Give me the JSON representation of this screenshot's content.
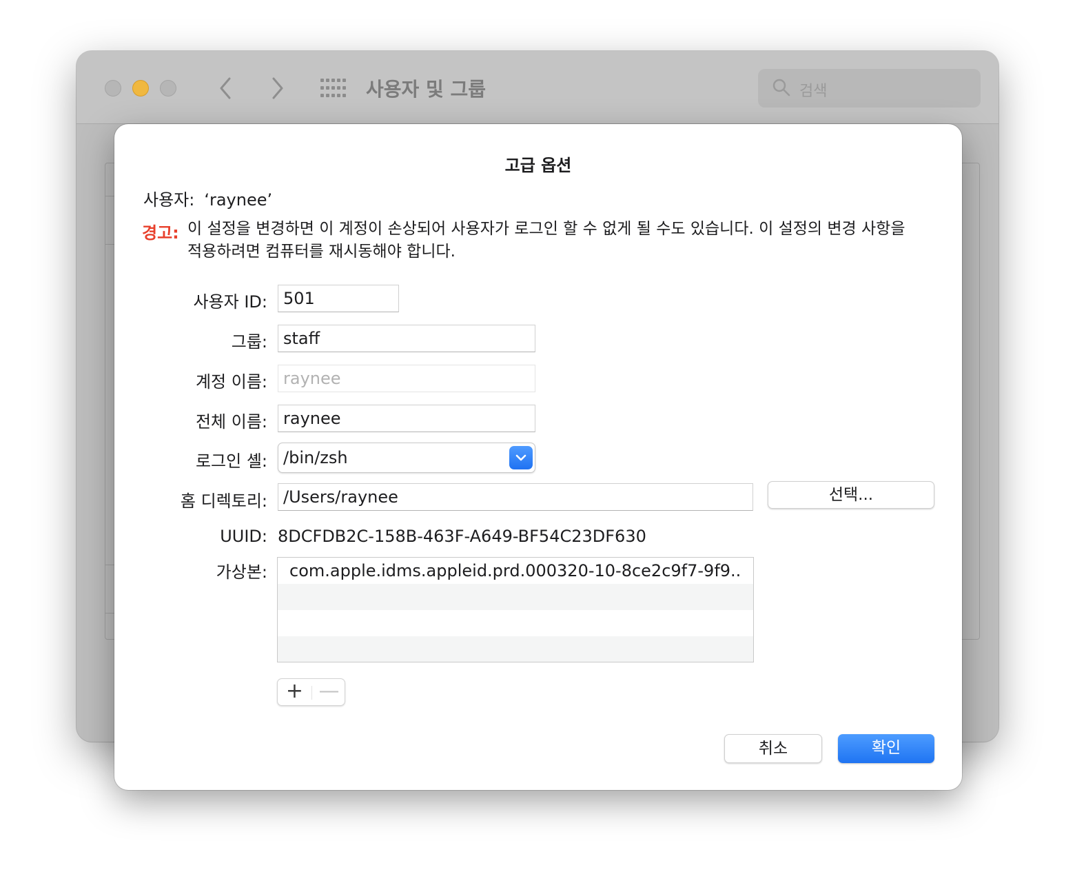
{
  "window": {
    "title": "사용자 및 그룹",
    "search_placeholder": "검색"
  },
  "dialog": {
    "title": "고급 옵션",
    "user_label": "사용자:",
    "user_value": "‘raynee’",
    "warning_label": "경고:",
    "warning_text": "이 설정을 변경하면 이 계정이 손상되어 사용자가 로그인 할 수 없게 될 수도 있습니다. 이 설정의 변경 사항을 적용하려면 컴퓨터를 재시동해야 합니다.",
    "fields": {
      "user_id": {
        "label": "사용자 ID:",
        "value": "501"
      },
      "group": {
        "label": "그룹:",
        "value": "staff"
      },
      "account_name": {
        "label": "계정 이름:",
        "value": "raynee"
      },
      "full_name": {
        "label": "전체 이름:",
        "value": "raynee"
      },
      "login_shell": {
        "label": "로그인 셸:",
        "value": "/bin/zsh"
      },
      "home_directory": {
        "label": "홈 디렉토리:",
        "value": "/Users/raynee"
      },
      "uuid": {
        "label": "UUID:",
        "value": "8DCFDB2C-158B-463F-A649-BF54C23DF630"
      },
      "aliases": {
        "label": "가상본:",
        "items": [
          "com.apple.idms.appleid.prd.000320-10-8ce2c9f7-9f9..",
          "",
          "",
          ""
        ]
      }
    },
    "select_button": "선택...",
    "add_button": "+",
    "remove_button": "—",
    "cancel_button": "취소",
    "ok_button": "확인"
  },
  "colors": {
    "warning": "#e8402c",
    "accent": "#1f74f2"
  }
}
